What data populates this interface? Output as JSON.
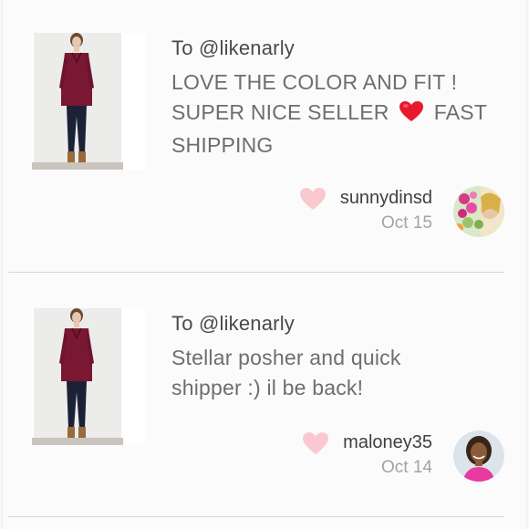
{
  "reviews": [
    {
      "recipient": "To @likenarly",
      "comment_line1": "LOVE THE COLOR AND FIT !",
      "comment_line2a": "SUPER NICE SELLER",
      "comment_line2b": "FAST",
      "comment_line3": "SHIPPING",
      "username": "sunnydinsd",
      "date": "Oct 15",
      "avatar_icon": "flower-bouquet-avatar-icon"
    },
    {
      "recipient": "To @likenarly",
      "comment_line1": "Stellar posher and quick",
      "comment_line2": "shipper :) il be back!",
      "username": "maloney35",
      "date": "Oct 14",
      "avatar_icon": "woman-portrait-avatar-icon"
    }
  ],
  "colors": {
    "like_heart": "#f9c9cf",
    "inline_heart": "#e8192c",
    "sweater": "#7a1733",
    "jeans": "#1c2236",
    "boots": "#9a6a3d"
  }
}
